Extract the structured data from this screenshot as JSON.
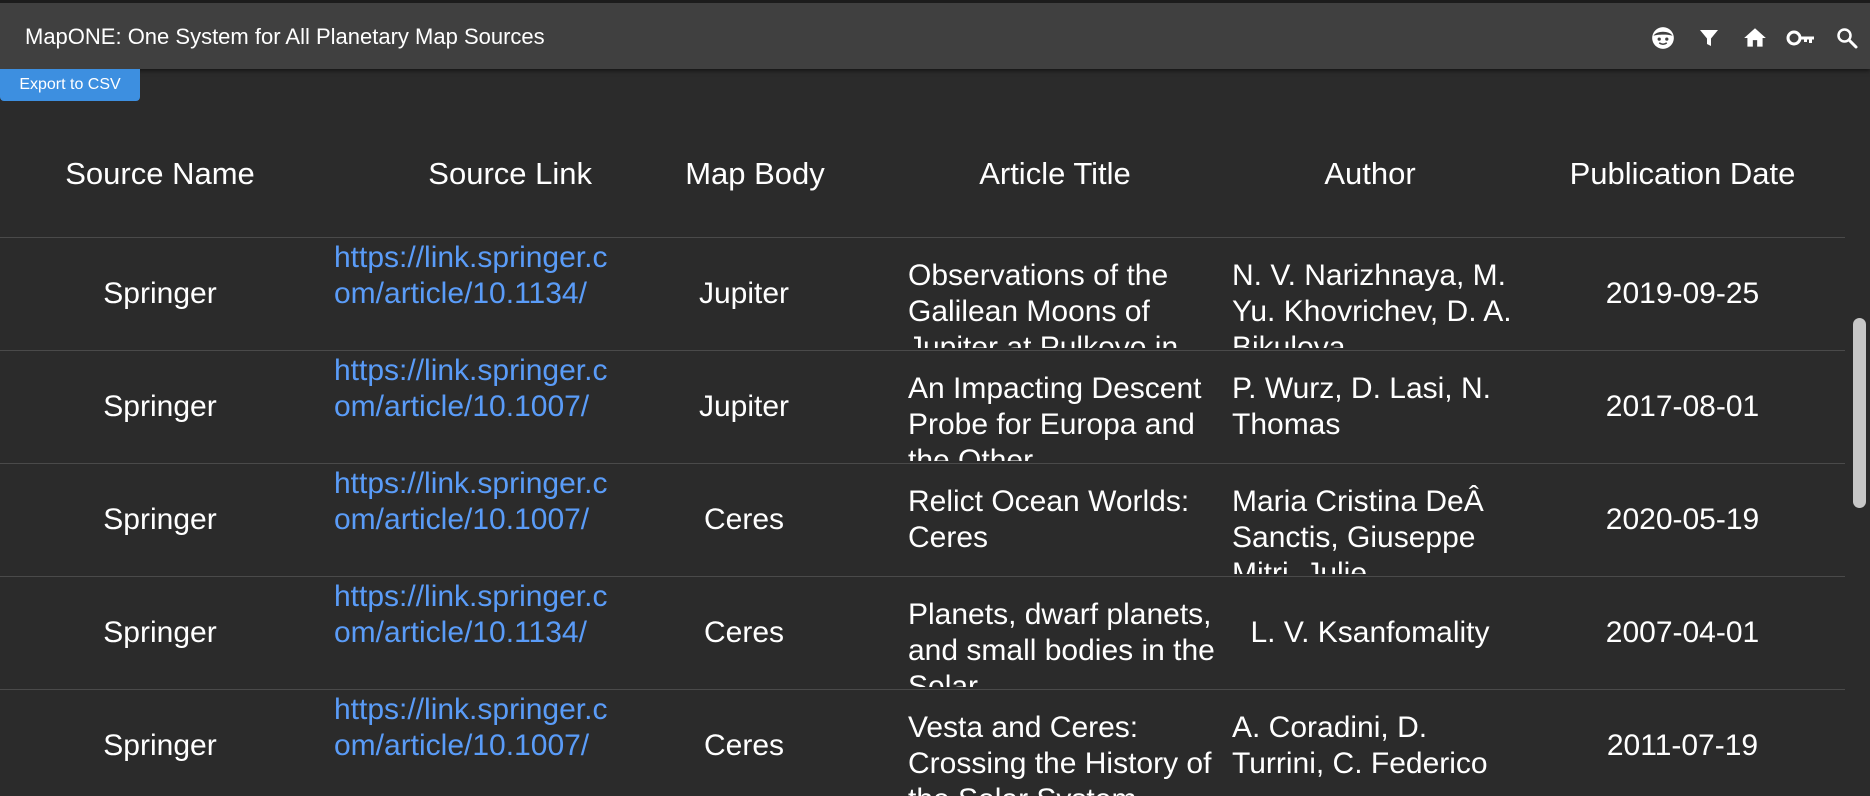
{
  "app": {
    "title": "MapONE: One System for All Planetary Map Sources"
  },
  "toolbar": {
    "icons": [
      "face-icon",
      "filter-icon",
      "home-icon",
      "key-icon",
      "search-icon"
    ],
    "export_label": "Export to CSV"
  },
  "table": {
    "headers": {
      "source_name": "Source Name",
      "source_link": "Source Link",
      "map_body": "Map Body",
      "article_title": "Article Title",
      "author": "Author",
      "publication_date": "Publication Date"
    },
    "rows": [
      {
        "source_name": "Springer",
        "source_link": "https://link.springer.com/article/10.1134/",
        "map_body": "Jupiter",
        "article_title": "Observations of the Galilean Moons of Jupiter at Pulkovo in",
        "author": "N. V. Narizhnaya, M. Yu. Khovrichev, D. A. Bikulova",
        "publication_date": "2019-09-25"
      },
      {
        "source_name": "Springer",
        "source_link": "https://link.springer.com/article/10.1007/",
        "map_body": "Jupiter",
        "article_title": "An Impacting Descent Probe for Europa and the Other",
        "author": "P. Wurz, D. Lasi, N. Thomas",
        "publication_date": "2017-08-01"
      },
      {
        "source_name": "Springer",
        "source_link": "https://link.springer.com/article/10.1007/",
        "map_body": "Ceres",
        "article_title": "Relict Ocean Worlds: Ceres",
        "author": "Maria Cristina DeÂ Sanctis, Giuseppe Mitri, Julie",
        "publication_date": "2020-05-19"
      },
      {
        "source_name": "Springer",
        "source_link": "https://link.springer.com/article/10.1134/",
        "map_body": "Ceres",
        "article_title": "Planets, dwarf planets, and small bodies in the Solar",
        "author": "L. V. Ksanfomality",
        "publication_date": "2007-04-01"
      },
      {
        "source_name": "Springer",
        "source_link": "https://link.springer.com/article/10.1007/",
        "map_body": "Ceres",
        "article_title": "Vesta and Ceres: Crossing the History of the Solar System",
        "author": "A. Coradini, D. Turrini, C. Federico",
        "publication_date": "2011-07-19"
      }
    ]
  }
}
